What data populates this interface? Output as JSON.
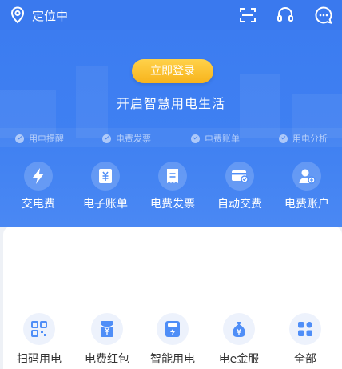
{
  "topbar": {
    "location_text": "定位中"
  },
  "hero": {
    "login_label": "立即登录",
    "slogan": "开启智慧用电生活",
    "features": [
      "用电提醒",
      "电费发票",
      "电费账单",
      "用电分析"
    ]
  },
  "quick_actions": [
    {
      "label": "交电费",
      "icon": "lightning-icon"
    },
    {
      "label": "电子账单",
      "icon": "yuan-bill-icon"
    },
    {
      "label": "电费发票",
      "icon": "invoice-icon"
    },
    {
      "label": "自动交费",
      "icon": "card-check-icon"
    },
    {
      "label": "电费账户",
      "icon": "user-account-icon"
    }
  ],
  "services": [
    {
      "label": "扫码用电",
      "icon": "qr-code-icon"
    },
    {
      "label": "电费红包",
      "icon": "red-packet-icon"
    },
    {
      "label": "智能用电",
      "icon": "smart-meter-icon"
    },
    {
      "label": "电e金服",
      "icon": "money-bag-icon"
    },
    {
      "label": "全部",
      "icon": "grid-all-icon"
    }
  ],
  "colors": {
    "primary": "#3f80f2",
    "accent_gold": "#f7b31c",
    "icon_blue": "#4f8ef7"
  }
}
